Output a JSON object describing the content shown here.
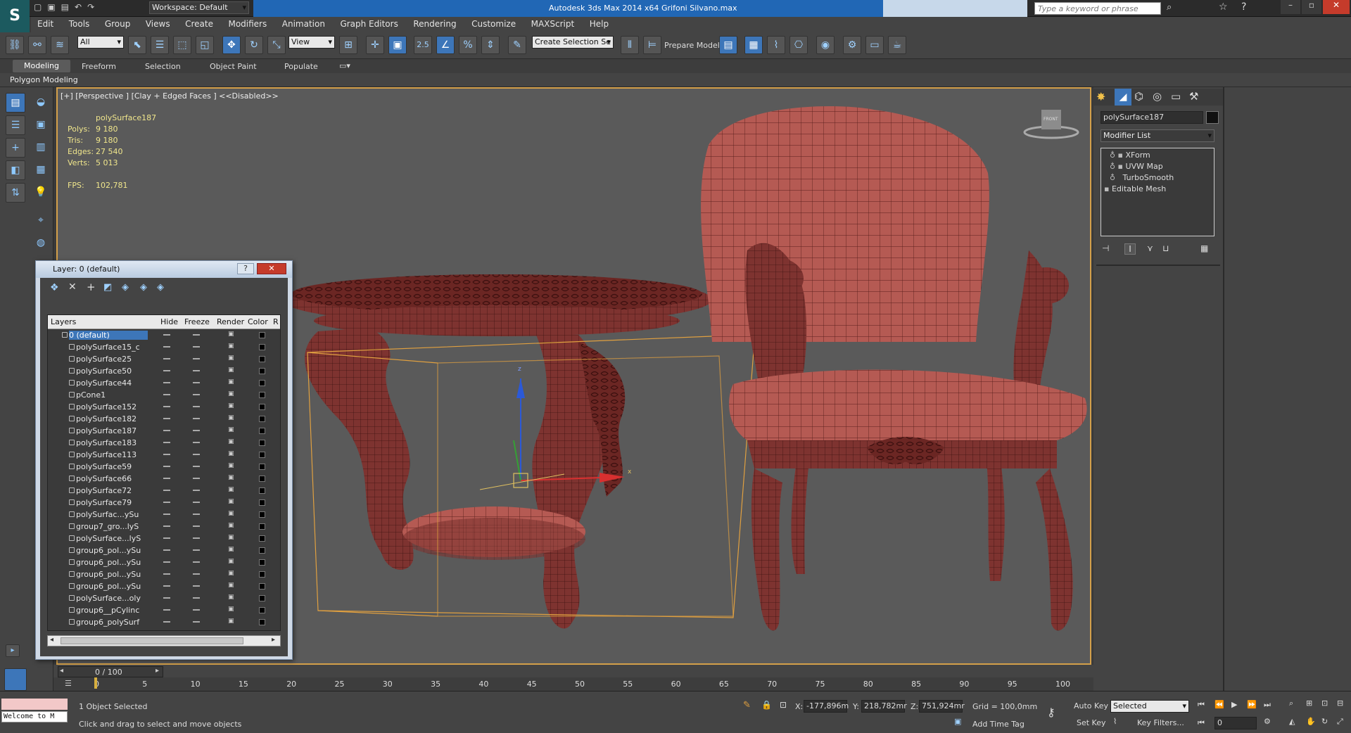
{
  "titlebar": {
    "workspace": "Workspace: Default",
    "app_title": "Autodesk 3ds Max  2014 x64",
    "file_name": "Grifoni Silvano.max",
    "search_placeholder": "Type a keyword or phrase"
  },
  "menu": [
    "Edit",
    "Tools",
    "Group",
    "Views",
    "Create",
    "Modifiers",
    "Animation",
    "Graph Editors",
    "Rendering",
    "Customize",
    "MAXScript",
    "Help"
  ],
  "toolbar": {
    "filter": "All",
    "ref_coord": "View",
    "snap_value": "2.5",
    "named_selection": "Create Selection Se",
    "prepare_model": "Prepare Model"
  },
  "ribbon": {
    "tabs": [
      "Modeling",
      "Freeform",
      "Selection",
      "Object Paint",
      "Populate"
    ],
    "active": "Modeling",
    "panel": "Polygon Modeling"
  },
  "viewport": {
    "label": "[+] [Perspective ] [Clay + Edged Faces ]  <<Disabled>>",
    "stats_object": "polySurface187",
    "stats": [
      {
        "k": "Polys:",
        "v": "9 180"
      },
      {
        "k": "Tris:",
        "v": "9 180"
      },
      {
        "k": "Edges:",
        "v": "27 540"
      },
      {
        "k": "Verts:",
        "v": "5 013"
      }
    ],
    "fps_label": "FPS:",
    "fps_value": "102,781",
    "viewcube_label": "FRONT",
    "axis_x": "x",
    "axis_z": "z"
  },
  "layer_dialog": {
    "title": "Layer: 0 (default)",
    "columns": [
      "Layers",
      "Hide",
      "Freeze",
      "Render",
      "Color",
      "R"
    ],
    "rows": [
      "0 (default)",
      "polySurface15_c",
      "polySurface25",
      "polySurface50",
      "polySurface44",
      "pCone1",
      "polySurface152",
      "polySurface182",
      "polySurface187",
      "polySurface183",
      "polySurface113",
      "polySurface59",
      "polySurface66",
      "polySurface72",
      "polySurface79",
      "polySurfac...ySu",
      "group7_gro...lyS",
      "polySurface...lyS",
      "group6_pol...ySu",
      "group6_pol...ySu",
      "group6_pol...ySu",
      "group6_pol...ySu",
      "polySurface...oly",
      "group6__pCylinc",
      "group6_polySurf"
    ]
  },
  "command_panel": {
    "object_name": "polySurface187",
    "modifier_list": "Modifier List",
    "stack": [
      "XForm",
      "UVW Map",
      "TurboSmooth",
      "Editable Mesh"
    ]
  },
  "timeline": {
    "frame": "0 / 100",
    "ticks": [
      "0",
      "5",
      "10",
      "15",
      "20",
      "25",
      "30",
      "35",
      "40",
      "45",
      "50",
      "55",
      "60",
      "65",
      "70",
      "75",
      "80",
      "85",
      "90",
      "95",
      "100"
    ]
  },
  "status": {
    "maxscript_listener": "Welcome to M",
    "selected": "1 Object Selected",
    "prompt": "Click and drag to select and move objects",
    "x_label": "X:",
    "x": "-177,896m",
    "y_label": "Y:",
    "y": "218,782mr",
    "z_label": "Z:",
    "z": "751,924mr",
    "grid": "Grid = 100,0mm",
    "add_time_tag": "Add Time Tag",
    "auto_key": "Auto Key",
    "set_key": "Set Key",
    "selected_dropdown": "Selected",
    "key_filters": "Key Filters...",
    "current_frame": "0"
  }
}
